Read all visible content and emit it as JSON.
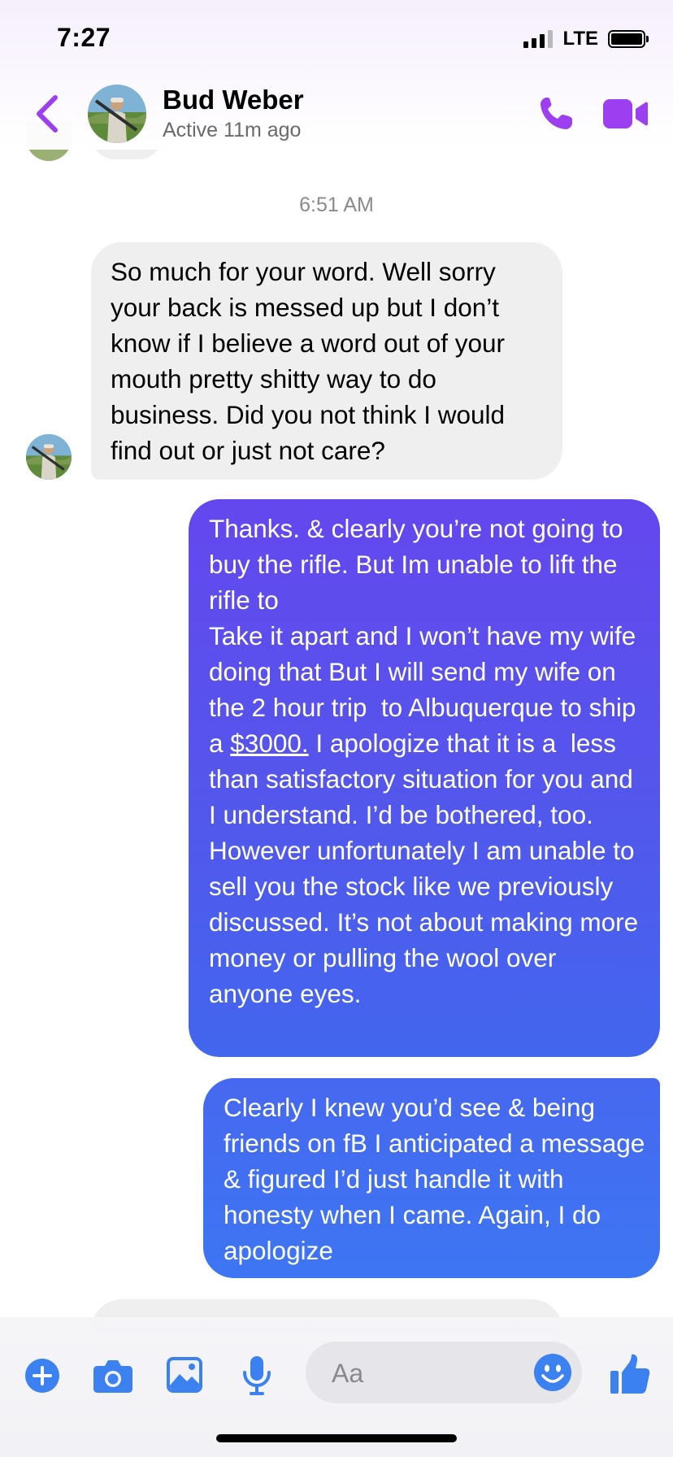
{
  "status_bar": {
    "time": "7:27",
    "network": "LTE"
  },
  "header": {
    "contact_name": "Bud Weber",
    "contact_status": "Active 11m ago",
    "back_icon": "chevron-left-icon",
    "call_icon": "phone-icon",
    "video_icon": "video-camera-icon",
    "accent_color": "#9b3ff0"
  },
  "conversation": {
    "timestamp": "6:51 AM",
    "messages": [
      {
        "direction": "incoming",
        "text": "So much for your word. Well sorry your back is messed up but I don’t know if I believe a word out of your mouth pretty shitty way to do business. Did you not think I would find out or just not care?"
      },
      {
        "direction": "outgoing",
        "text_before": "Thanks. & clearly you’re not going to buy the rifle. But Im unable to lift the rifle to\nTake it apart and I won’t have my wife doing that But I will send my wife on the 2 hour trip  to Albuquerque to ship a ",
        "amount": "$3000.",
        "text_after": " I apologize that it is a  less than satisfactory situation for you and I understand. I’d be bothered, too. However unfortunately I am unable to sell you the stock like we previously discussed. It’s not about making more money or pulling the wool over anyone eyes."
      },
      {
        "direction": "outgoing",
        "text": "Clearly I knew you’d see & being friends on fB I anticipated a message & figured I’d just handle it with honesty when I came. Again, I do apologize"
      }
    ],
    "incoming_bubble_color": "#efeff0",
    "outgoing_gradient": [
      "#6447ee",
      "#3d76f3"
    ]
  },
  "composer": {
    "placeholder": "Aa",
    "icons": [
      "plus-circle-icon",
      "camera-icon",
      "photo-icon",
      "microphone-icon",
      "emoji-icon",
      "thumbs-up-icon"
    ],
    "icon_color": "#3b82f0"
  }
}
